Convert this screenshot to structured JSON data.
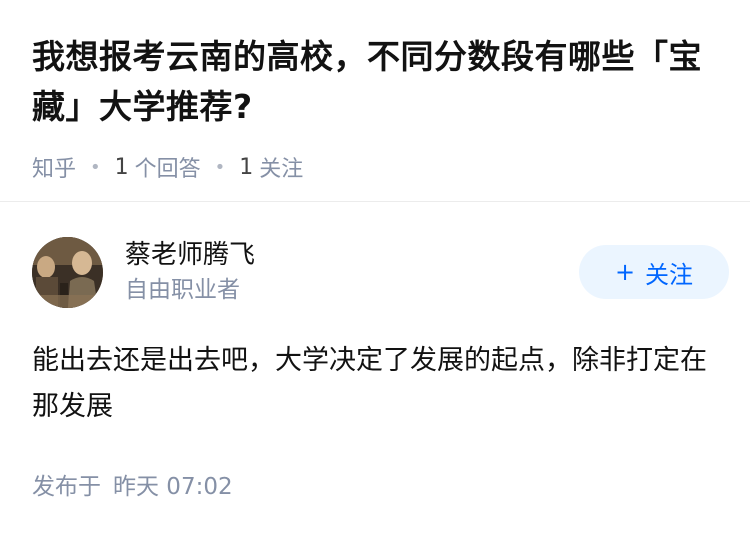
{
  "question": {
    "title": "我想报考云南的高校，不同分数段有哪些「宝藏」大学推荐?",
    "source": "知乎",
    "answer_count": "1",
    "answer_label": "个回答",
    "follower_count": "1",
    "follower_label": "关注"
  },
  "answer": {
    "author_name": "蔡老师腾飞",
    "author_desc": "自由职业者",
    "follow_label": "关注",
    "content": "能出去还是出去吧，大学决定了发展的起点，除非打定在那发展",
    "published_prefix": "发布于",
    "published_time": "昨天 07:02"
  },
  "icons": {
    "follow": "plus-icon",
    "avatar": "avatar-image"
  },
  "colors": {
    "accent": "#0066ff",
    "accent_bg": "#ebf5ff",
    "meta": "#8590a6",
    "text": "#121212"
  }
}
